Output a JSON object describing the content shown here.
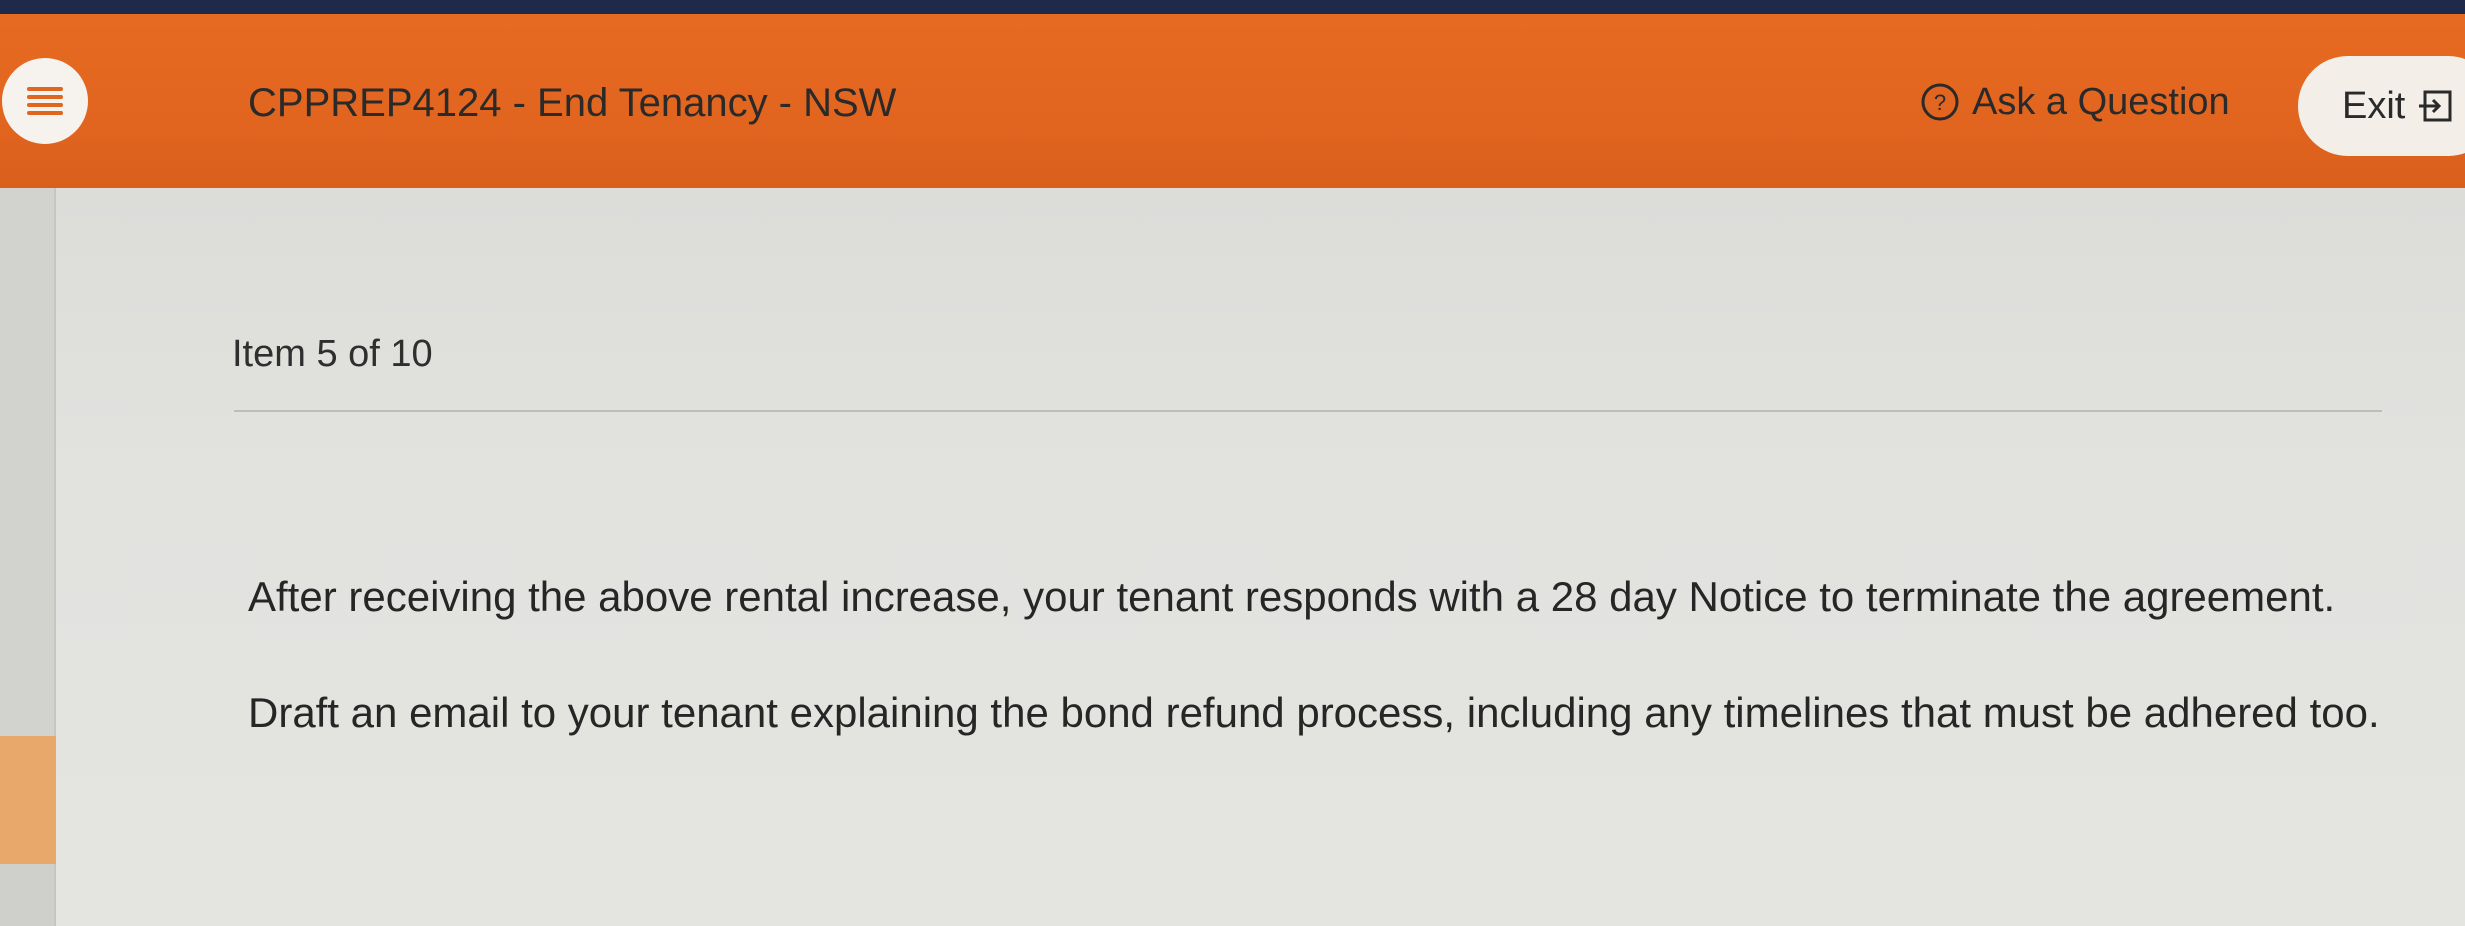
{
  "header": {
    "course_title": "CPPREP4124 - End Tenancy - NSW",
    "ask_label": "Ask a Question",
    "exit_label": "Exit",
    "accent_color": "#e2651f"
  },
  "icons": {
    "menu": "hamburger-menu-icon",
    "help": "question-circle-icon",
    "exit": "exit-door-icon"
  },
  "main": {
    "item_counter": "Item 5 of 10",
    "question_paragraph_1": "After receiving the above rental increase, your tenant responds with a 28 day Notice to terminate the agreement.",
    "question_paragraph_2": "Draft an email to your tenant explaining the bond refund process, including any timelines that must be adhered too."
  }
}
